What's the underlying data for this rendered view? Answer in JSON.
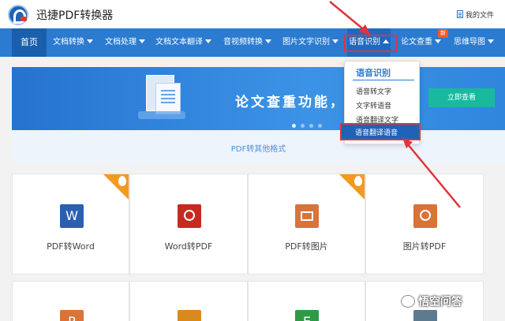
{
  "app": {
    "title": "迅捷PDF转换器",
    "my_files": "我的文件"
  },
  "nav": {
    "home": "首页",
    "items": [
      "文档转换",
      "文档处理",
      "文档文本翻译",
      "音视频转换",
      "图片文字识别",
      "语音识别",
      "论文查重",
      "思维导图"
    ],
    "badge": "新"
  },
  "banner": {
    "text": "论文查重功能，就",
    "cta": "立即查看"
  },
  "strip": {
    "label": "PDF转其他格式"
  },
  "dropdown": {
    "title": "语音识别",
    "items": [
      "语音转文字",
      "文字转语音",
      "语音翻译文字",
      "语音翻译语音"
    ],
    "selected_index": 3
  },
  "cards": [
    {
      "label": "PDF转Word",
      "icon": "word-icon",
      "color": "#2b5fb0",
      "glyph": "W",
      "hot": true
    },
    {
      "label": "Word转PDF",
      "icon": "pdf-icon",
      "color": "#c62b20",
      "glyph": "",
      "hot": false
    },
    {
      "label": "PDF转图片",
      "icon": "image-icon",
      "color": "#d9733a",
      "glyph": "",
      "hot": true
    },
    {
      "label": "图片转PDF",
      "icon": "pdf-icon",
      "color": "#d9733a",
      "glyph": "",
      "hot": false
    }
  ],
  "bottom_cards": [
    {
      "icon": "ppt-icon",
      "color": "#d9733a",
      "glyph": "P"
    },
    {
      "icon": "image-icon",
      "color": "#d98a1e",
      "glyph": ""
    },
    {
      "icon": "excel-icon",
      "color": "#2f9a45",
      "glyph": "E"
    },
    {
      "icon": "doc-icon",
      "color": "#5e7a8f",
      "glyph": ""
    }
  ],
  "watermark": "悟空问答",
  "colors": {
    "nav": "#2b7bd1",
    "accent_red": "#e0353a",
    "cta": "#19b9a0"
  }
}
